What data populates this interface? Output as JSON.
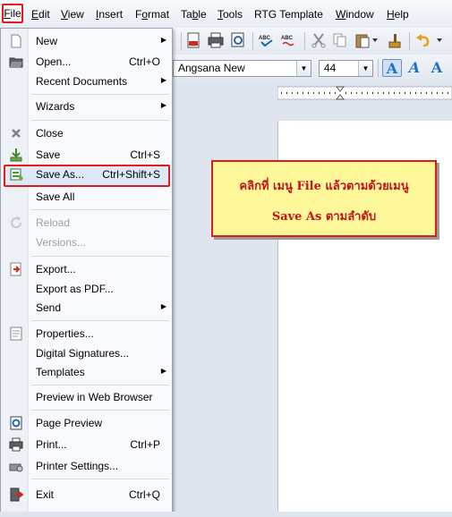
{
  "menubar": {
    "items": [
      "File",
      "Edit",
      "View",
      "Insert",
      "Format",
      "Table",
      "Tools",
      "RTG Template",
      "Window",
      "Help"
    ],
    "mnemonic_letters": [
      "F",
      "E",
      "V",
      "I",
      "o",
      "b",
      "T",
      "",
      "W",
      "H"
    ]
  },
  "format_toolbar": {
    "font_name": "Angsana New",
    "font_size": "44",
    "shadow_a": "A",
    "italic_a": "A",
    "plain_a": "A"
  },
  "file_menu": {
    "new": "New",
    "open": "Open...",
    "open_shortcut": "Ctrl+O",
    "recent": "Recent Documents",
    "wizards": "Wizards",
    "close": "Close",
    "save": "Save",
    "save_shortcut": "Ctrl+S",
    "save_as": "Save As...",
    "save_as_shortcut": "Ctrl+Shift+S",
    "save_all": "Save All",
    "reload": "Reload",
    "versions": "Versions...",
    "export": "Export...",
    "export_pdf": "Export as PDF...",
    "send": "Send",
    "properties": "Properties...",
    "digital_signatures": "Digital Signatures...",
    "templates": "Templates",
    "preview_web": "Preview in Web Browser",
    "page_preview": "Page Preview",
    "print": "Print...",
    "print_shortcut": "Ctrl+P",
    "printer_settings": "Printer Settings...",
    "exit": "Exit",
    "exit_shortcut": "Ctrl+Q"
  },
  "callout": {
    "line1": "คลิกที่ เมนู File แล้วตามด้วยเมนู",
    "line2": "Save As ตามลำดับ"
  },
  "colors": {
    "highlight_border": "#e31a1a",
    "callout_bg": "#fdf79a",
    "callout_text": "#c1141b"
  }
}
